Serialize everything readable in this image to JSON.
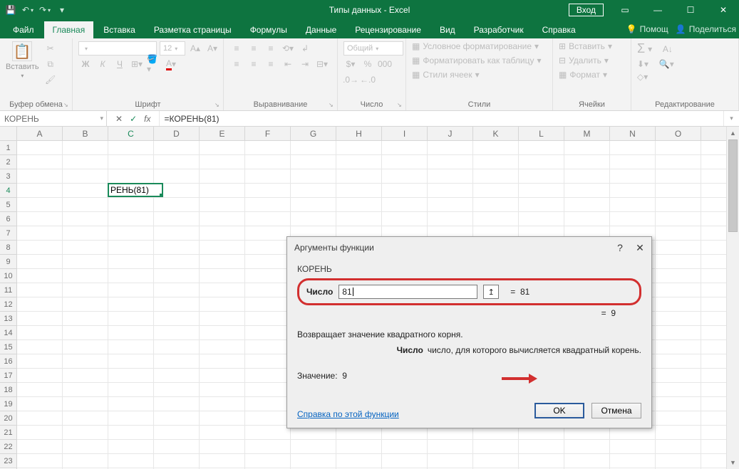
{
  "title": "Типы данных  -  Excel",
  "login": "Вход",
  "tabs": [
    "Файл",
    "Главная",
    "Вставка",
    "Разметка страницы",
    "Формулы",
    "Данные",
    "Рецензирование",
    "Вид",
    "Разработчик",
    "Справка"
  ],
  "active_tab": 1,
  "help_extra": {
    "bulb": "Помощ",
    "share": "Поделиться"
  },
  "ribbon": {
    "clipboard": {
      "label": "Буфер обмена",
      "paste": "Вставить"
    },
    "font": {
      "label": "Шрифт",
      "name": "",
      "size": "12",
      "buttons": [
        "Ж",
        "К",
        "Ч"
      ]
    },
    "alignment": {
      "label": "Выравнивание"
    },
    "number": {
      "label": "Число",
      "format": "Общий"
    },
    "styles": {
      "label": "Стили",
      "cond": "Условное форматирование",
      "table": "Форматировать как таблицу",
      "cell": "Стили ячеек"
    },
    "cells": {
      "label": "Ячейки",
      "insert": "Вставить",
      "delete": "Удалить",
      "format": "Формат"
    },
    "editing": {
      "label": "Редактирование"
    }
  },
  "namebox": "КОРЕНЬ",
  "formula": "=КОРЕНЬ(81)",
  "columns": [
    "A",
    "B",
    "C",
    "D",
    "E",
    "F",
    "G",
    "H",
    "I",
    "J",
    "K",
    "L",
    "M",
    "N",
    "O"
  ],
  "rows": 23,
  "active_cell": {
    "col": "C",
    "row": 4,
    "display": "РЕНЬ(81)"
  },
  "dialog": {
    "title": "Аргументы функции",
    "fn": "КОРЕНЬ",
    "arg_label": "Число",
    "arg_value": "81",
    "arg_eval": "81",
    "final_eval": "9",
    "desc": "Возвращает значение квадратного корня.",
    "arg_desc_label": "Число",
    "arg_desc": "число, для которого вычисляется квадратный корень.",
    "value_label": "Значение:",
    "value": "9",
    "help": "Справка по этой функции",
    "ok": "OK",
    "cancel": "Отмена"
  }
}
